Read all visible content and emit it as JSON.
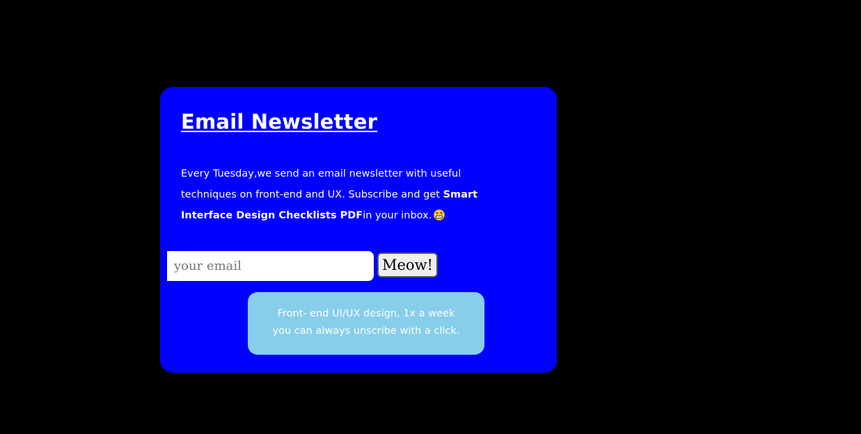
{
  "newsletter": {
    "title": "Email Newsletter",
    "description_intro": "Every Tuesday,we send an email newsletter with useful techniques on front-end and UX. Subscribe and get ",
    "description_bold": "Smart Interface Design Checklists PDF",
    "description_outro": "in your inbox.",
    "emoji_icon": "grimacing-face-icon",
    "email_placeholder": "your email",
    "email_value": "",
    "submit_label": "Meow!",
    "note_line1": "Front- end UI/UX design, 1x a week",
    "note_line2": "you can always unscribe with a click."
  },
  "colors": {
    "background": "#000000",
    "card": "#0000ff",
    "note_box": "#87ceeb",
    "text": "#ffffff"
  }
}
